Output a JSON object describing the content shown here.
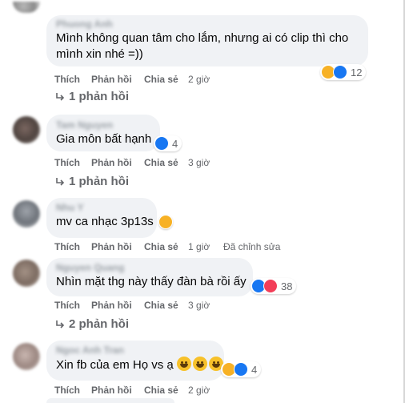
{
  "comments": [
    {
      "text_line1": "Mình không quan tâm cho lắm, nhưng ai có clip thì cho",
      "text_line2": "mình xin nhé =))",
      "reaction_count": "12",
      "reactions": [
        "haha-icon",
        "like-icon"
      ],
      "time": "2 giờ",
      "replies": "1 phản hồi"
    },
    {
      "text": "Gia môn bất hạnh",
      "reaction_count": "4",
      "reactions": [
        "like-icon"
      ],
      "time": "3 giờ",
      "replies": "1 phản hồi"
    },
    {
      "text": "mv ca nhạc 3p13s",
      "reactions": [
        "haha-icon"
      ],
      "time": "1 giờ",
      "edited": "Đã chỉnh sửa"
    },
    {
      "text": "Nhìn mặt thg này thấy đàn bà rồi ấy",
      "reaction_count": "38",
      "reactions": [
        "like-icon",
        "love-icon"
      ],
      "time": "3 giờ",
      "replies": "2 phản hồi"
    },
    {
      "text": "Xin fb của em Họ vs ạ",
      "reaction_count": "4",
      "reactions": [
        "haha-icon",
        "like-icon"
      ],
      "time": "2 giờ"
    }
  ],
  "labels": {
    "like": "Thích",
    "reply": "Phản hồi",
    "share": "Chia sẻ"
  },
  "colors": {
    "bubble_bg": "#f0f2f5",
    "action_text": "#65676b",
    "like_blue": "#1877f2",
    "haha_yellow": "#f7b125",
    "love_red": "#f33e58"
  }
}
